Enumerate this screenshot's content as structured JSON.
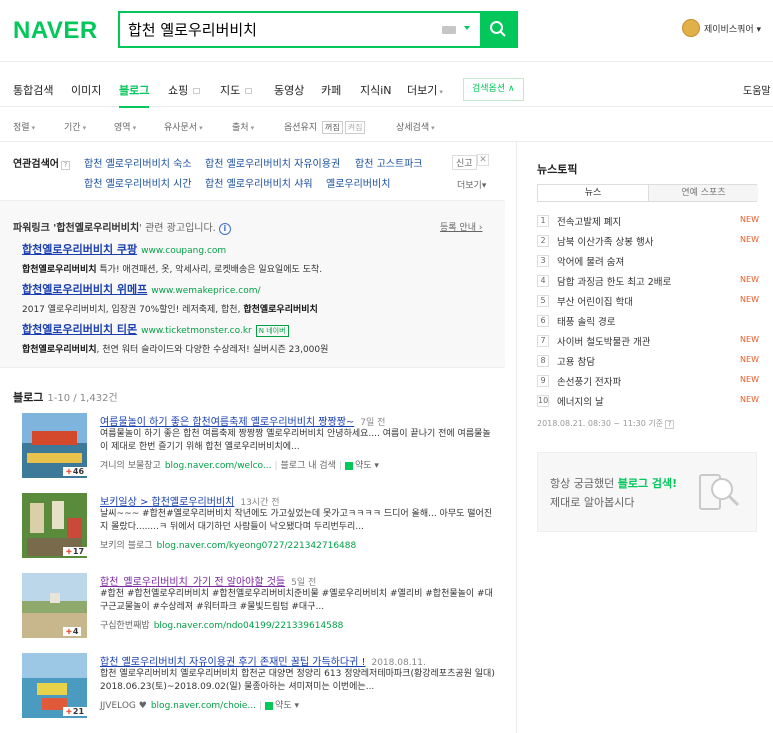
{
  "header": {
    "logo": "NAVER",
    "search_value": "합천 옐로우리버비치",
    "user_name": "제이비스쿼어 ▾"
  },
  "tabs": [
    {
      "label": "통합검색"
    },
    {
      "label": "이미지"
    },
    {
      "label": "블로그"
    },
    {
      "label": "쇼핑"
    },
    {
      "label": "지도"
    },
    {
      "label": "동영상"
    },
    {
      "label": "카페"
    },
    {
      "label": "지식iN"
    },
    {
      "label": "더보기"
    }
  ],
  "search_options_label": "검색옵션 ∧",
  "right_edge_label": "도움말",
  "filters": {
    "sort": "정렬",
    "period": "기간",
    "area": "영역",
    "similar": "유사문서",
    "source": "출처",
    "keep_label": "옵션유지",
    "keep_off": "꺼짐",
    "keep_on": "켜짐",
    "detail": "상세검색"
  },
  "related": {
    "label": "연관검색어",
    "help": "?",
    "links": [
      "합천 옐로우리버비치 숙소",
      "합천 옐로우리버비치 자유이용권",
      "합천 고스트파크",
      "합천 옐로우리버비치 시간",
      "합천 옐로우리버비치 샤워",
      "옐로우리버비치"
    ],
    "report": "신고",
    "more": "더보기▾"
  },
  "powerlink": {
    "title_prefix": "파워링크 '",
    "title_kw": "합천옐로우리버비치",
    "title_suffix": "' 관련 광고입니다.",
    "register": "등록 안내 ›",
    "ads": [
      {
        "title": "합천옐로우리버비치 쿠팡",
        "url": "www.coupang.com",
        "desc_kw": "합천옐로우리버비치",
        "desc": " 특가! 애견패션, 옷, 악세사리, 로켓배송은 일요일에도 도착.",
        "badge": ""
      },
      {
        "title": "합천옐로우리버비치 위메프",
        "url": "www.wemakeprice.com/",
        "desc_prefix": "2017 옐로우리버비치, 입장권 70%할인! 레저축제, 합천, ",
        "desc_kw": "합천옐로우리버비치",
        "badge": ""
      },
      {
        "title": "합천옐로우리버비치 티몬",
        "url": "www.ticketmonster.co.kr",
        "badge": "N 네이버",
        "desc_kw": "합천옐로우리버비치",
        "desc": ", 천연 워터 슬라이드와 다양한 수상레저! 실버시즌 23,000원"
      }
    ]
  },
  "blog": {
    "label": "블로그",
    "count": "1-10 / 1,432건",
    "posts": [
      {
        "title": "여름물놀이 하기 좋은 합천여름축제 옐로우리버비치 짱짱짱~",
        "age": "7일 전",
        "desc": "여름물놀이 하기 좋은 합천 여름축제 짱짱짱 옐로우리버비치 안녕하세요.... 여름이 끝나기 전에 여름물놀이 제대로 한번 즐기기 위해 합천 옐로우리버비치에...",
        "author": "겨니의 보물창고",
        "url": "blog.naver.com/welco...",
        "extra": "블로그 내 검색",
        "map": "약도 ▾",
        "count": "46"
      },
      {
        "title": "보키일상 > 합천옐로우리버비치",
        "age": "13시간 전",
        "desc": "날씨~~~ #합천#옐로우리버비치 작년에도 가고싶었는데 못가고ㅋㅋㅋㅋ 드디어 올해... 아무도 떨어진지 몰랐다........ㅋ 뒤에서 대기하던 사람들이 낙오됐다며 두리번두리...",
        "author": "보키의 블로그",
        "url": "blog.naver.com/kyeong0727/221342716488",
        "count": "17"
      },
      {
        "title": "합천_옐로우리버비치_가기 전 알아야할 것들",
        "age": "5일 전",
        "desc": "#합천 #합천옐로우리버비치 #합천옐로우리버비치준비물 #옐로우리버비치 #옐리비 #합천물놀이 #대구근교물놀이 #수상레져 #워터파크 #물빛드림텀 #대구...",
        "author": "구십한번째밥",
        "url": "blog.naver.com/ndo04199/221339614588",
        "count": "4"
      },
      {
        "title": "합천 옐로우리버비치 자유이용권 후기 존재민 꿀팁 가득하다귀 !",
        "age": "2018.08.11.",
        "desc": "합천 옐로우리버비치 옐로우리버비치 합천군 대양면 정양리 613 정양레저테마파크(황강레포츠공원 일대) 2018.06.23(토)~2018.09.02(일) 물종아하는 셔미져미는 이번에는...",
        "author": "JJVELOG ♥",
        "url": "blog.naver.com/choie...",
        "map": "약도 ▾",
        "count": "21"
      }
    ]
  },
  "newstopic": {
    "title": "뉴스토픽",
    "tab_news": "뉴스",
    "tab_ent": "연예 스포츠",
    "items": [
      {
        "num": "1",
        "text": "전속고발제 폐지",
        "new": "NEW"
      },
      {
        "num": "2",
        "text": "남북 이산가족 상봉 행사",
        "new": "NEW"
      },
      {
        "num": "3",
        "text": "악어에 물려 숨져",
        "new": ""
      },
      {
        "num": "4",
        "text": "담합 과징금 한도 최고 2배로",
        "new": "NEW"
      },
      {
        "num": "5",
        "text": "부산 어린이집 학대",
        "new": "NEW"
      },
      {
        "num": "6",
        "text": "태풍 솔릭 경로",
        "new": ""
      },
      {
        "num": "7",
        "text": "사이버 철도박물관 개관",
        "new": "NEW"
      },
      {
        "num": "8",
        "text": "고용 참담",
        "new": "NEW"
      },
      {
        "num": "9",
        "text": "손선풍기 전자파",
        "new": "NEW"
      },
      {
        "num": "10",
        "text": "에너지의 날",
        "new": "NEW"
      }
    ],
    "time": "2018.08.21. 08:30 ~ 11:30 기준"
  },
  "promo": {
    "line1_prefix": "항상 궁금했던 ",
    "line1_kw": "블로그 검색!",
    "line2": "제대로 알아봅시다"
  },
  "colors": {
    "brand": "#03c75a",
    "link": "#1a3fb0",
    "new": "#ee5b29"
  }
}
